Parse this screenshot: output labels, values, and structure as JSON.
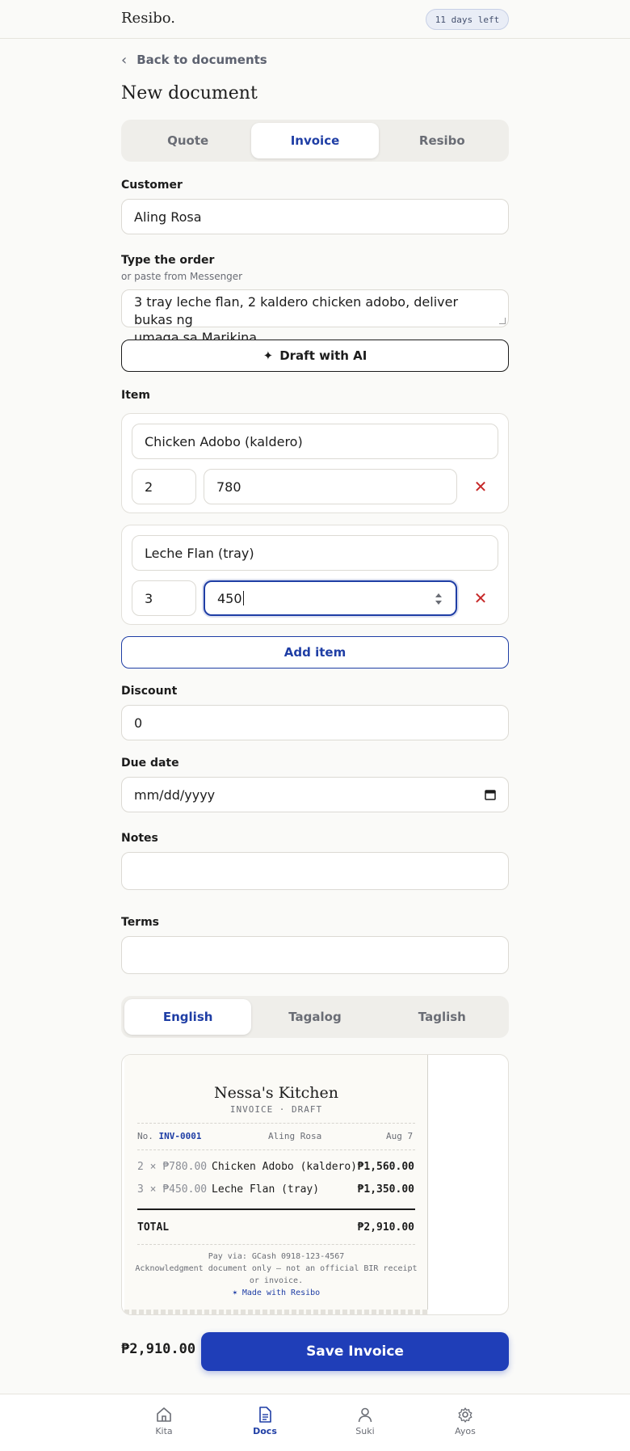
{
  "header": {
    "brand": "Resibo.",
    "trial_badge": "11 days left"
  },
  "nav_back": {
    "label": "Back to documents"
  },
  "page": {
    "title": "New document"
  },
  "doc_type_tabs": [
    {
      "label": "Quote",
      "active": false
    },
    {
      "label": "Invoice",
      "active": true
    },
    {
      "label": "Resibo",
      "active": false
    }
  ],
  "customer": {
    "label": "Customer",
    "value": "Aling Rosa"
  },
  "order": {
    "label": "Type the order",
    "sublabel": "or paste from Messenger",
    "value_line1": "3 tray leche flan, 2 kaldero chicken adobo, deliver bukas ng",
    "value_line2": "umaga sa Marikina"
  },
  "draft_ai": {
    "label": "Draft with AI",
    "icon": "sparkle-icon"
  },
  "items_section": {
    "label": "Item"
  },
  "items": [
    {
      "name": "Chicken Adobo (kaldero)",
      "qty": "2",
      "price": "780"
    },
    {
      "name": "Leche Flan (tray)",
      "qty": "3",
      "price": "450"
    }
  ],
  "add_item": {
    "label": "Add item"
  },
  "discount": {
    "label": "Discount",
    "value": "0"
  },
  "due_date": {
    "label": "Due date",
    "placeholder": "mm/dd/yyyy"
  },
  "notes": {
    "label": "Notes",
    "value": ""
  },
  "terms": {
    "label": "Terms",
    "value": ""
  },
  "language_tabs": [
    {
      "label": "English",
      "active": true
    },
    {
      "label": "Tagalog",
      "active": false
    },
    {
      "label": "Taglish",
      "active": false
    }
  ],
  "receipt": {
    "shop_name": "Nessa's Kitchen",
    "doc_type": "INVOICE · DRAFT",
    "no_label": "No.",
    "doc_no": "INV-0001",
    "customer": "Aling Rosa",
    "date": "Aug 7",
    "lines": [
      {
        "qty_price": "2 × ₱780.00",
        "name": "Chicken Adobo (kaldero)",
        "amount": "₱1,560.00"
      },
      {
        "qty_price": "3 × ₱450.00",
        "name": "Leche Flan (tray)",
        "amount": "₱1,350.00"
      }
    ],
    "total_label": "TOTAL",
    "total_value": "₱2,910.00",
    "pay_via": "Pay via: GCash 0918-123-4567",
    "disclaimer_line1": "Acknowledgment document only — not an official BIR receipt",
    "disclaimer_line2": "or invoice.",
    "made_with": "✶ Made with Resibo"
  },
  "footer": {
    "total": "₱2,910.00",
    "save_label": "Save Invoice"
  },
  "bottom_nav": [
    {
      "label": "Kita",
      "icon": "home-icon",
      "active": false
    },
    {
      "label": "Docs",
      "icon": "document-icon",
      "active": true
    },
    {
      "label": "Suki",
      "icon": "person-icon",
      "active": false
    },
    {
      "label": "Ayos",
      "icon": "gear-icon",
      "active": false
    }
  ],
  "colors": {
    "accent": "#1f3ea5",
    "danger": "#c62828",
    "background": "#fafaf8"
  }
}
